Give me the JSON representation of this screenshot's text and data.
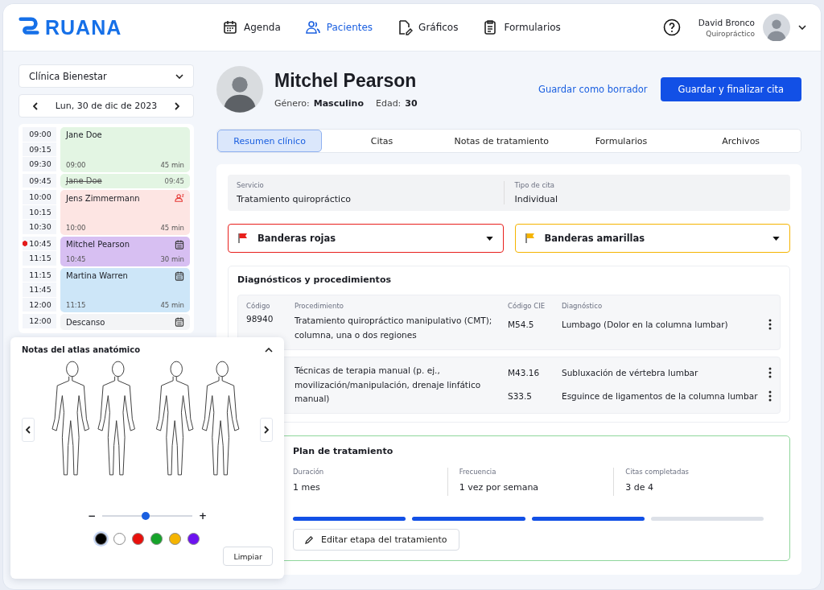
{
  "header": {
    "brand": "RUANA",
    "nav": [
      {
        "label": "Agenda",
        "selected": false
      },
      {
        "label": "Pacientes",
        "selected": true
      },
      {
        "label": "Gráficos",
        "selected": false
      },
      {
        "label": "Formularios",
        "selected": false
      }
    ],
    "user": {
      "name": "David Bronco",
      "role": "Quiropráctico"
    }
  },
  "sidebar": {
    "clinic": "Clínica Bienestar",
    "date": "Lun, 30 de dic de 2023",
    "schedule": [
      {
        "times": [
          {
            "label": "09:00",
            "current": false
          },
          {
            "label": "09:15",
            "current": false
          },
          {
            "label": "09:30",
            "current": false
          }
        ],
        "name": "Jane Doe",
        "start": "09:00",
        "duration": "45 min",
        "color": "#e3f5e3",
        "kind": "plain",
        "cancelled": false
      },
      {
        "times": [
          {
            "label": "09:45",
            "current": false
          }
        ],
        "name": "Jane Doe",
        "start": "09:45",
        "color": "#e3f5e3",
        "kind": "plain",
        "cancelled": true
      },
      {
        "times": [
          {
            "label": "10:00",
            "current": false
          },
          {
            "label": "10:15",
            "current": false
          },
          {
            "label": "10:30",
            "current": false
          }
        ],
        "name": "Jens Zimmermann",
        "start": "10:00",
        "duration": "45 min",
        "color": "#fde5e3",
        "kind": "new_patient",
        "cancelled": false
      },
      {
        "times": [
          {
            "label": "10:45",
            "current": true
          },
          {
            "label": "11:15",
            "current": false
          }
        ],
        "name": "Mitchel Pearson",
        "start": "10:45",
        "duration": "30 min",
        "color": "#d7bff2",
        "kind": "booked",
        "cancelled": false
      },
      {
        "times": [
          {
            "label": "11:15",
            "current": false
          },
          {
            "label": "11:45",
            "current": false
          },
          {
            "label": "12:00",
            "current": false
          }
        ],
        "name": "Martina Warren",
        "start": "11:15",
        "duration": "45 min",
        "color": "#cde6f8",
        "kind": "booked",
        "cancelled": false
      },
      {
        "times": [
          {
            "label": "12:00",
            "current": false
          }
        ],
        "name": "Descanso",
        "color": "#f3f4f6",
        "kind": "booked",
        "cancelled": false
      }
    ]
  },
  "patient": {
    "name": "Mitchel Pearson",
    "gender_label": "Género:",
    "gender": "Masculino",
    "age_label": "Edad:",
    "age": "30",
    "draft_button": "Guardar como borrador",
    "save_button": "Guardar y finalizar cita"
  },
  "tabs": [
    {
      "label": "Resumen clínico",
      "selected": true
    },
    {
      "label": "Citas",
      "selected": false
    },
    {
      "label": "Notas de tratamiento",
      "selected": false
    },
    {
      "label": "Formularios",
      "selected": false
    },
    {
      "label": "Archivos",
      "selected": false
    }
  ],
  "service": {
    "service_label": "Servicio",
    "service": "Tratamiento quiropráctico",
    "type_label": "Tipo de cita",
    "type": "Individual"
  },
  "flags": [
    {
      "label": "Banderas rojas",
      "color": "#e8201c"
    },
    {
      "label": "Banderas amarillas",
      "color": "#f5b400"
    }
  ],
  "diagnostics": {
    "title": "Diagnósticos y procedimientos",
    "columns": [
      "Código",
      "Procedimiento",
      "Código CIE",
      "Diagnóstico"
    ],
    "rows": [
      {
        "code": "98940",
        "procedure": "Tratamiento quiropráctico manipulativo (CMT); columna, una o dos regiones",
        "diagnoses": [
          {
            "icd": "M54.5",
            "diagnosis": "Lumbago (Dolor en la columna lumbar)"
          }
        ]
      },
      {
        "procedure": "Técnicas de terapia manual (p. ej., movilización/manipulación, drenaje linfático manual)",
        "diagnoses": [
          {
            "icd": "M43.16",
            "diagnosis": "Subluxación de vértebra lumbar"
          },
          {
            "icd": "S33.5",
            "diagnosis": "Esguince de ligamentos de la columna lumbar"
          }
        ]
      }
    ]
  },
  "plan": {
    "title": "Plan de tratamiento",
    "fields": [
      {
        "label": "Duración",
        "value": "1 mes"
      },
      {
        "label": "Frecuencia",
        "value": "1 vez por semana"
      },
      {
        "label": "Citas completadas",
        "value": "3 de 4"
      }
    ],
    "progress": [
      {
        "completed": true
      },
      {
        "completed": true
      },
      {
        "completed": true
      },
      {
        "completed": false
      }
    ],
    "edit_button": "Editar etapa del tratamiento"
  },
  "atlas": {
    "title": "Notas del atlas anatómico",
    "zoom": {
      "minus": "−",
      "plus": "+",
      "level": 0.48
    },
    "colors": [
      {
        "color": "#000000",
        "selected": true
      },
      {
        "color": "#ffffff",
        "selected": false
      },
      {
        "color": "#e8100c",
        "selected": false
      },
      {
        "color": "#16a32a",
        "selected": false
      },
      {
        "color": "#f5b400",
        "selected": false
      },
      {
        "color": "#6d12f0",
        "selected": false
      }
    ],
    "clear_button": "Limpiar"
  }
}
